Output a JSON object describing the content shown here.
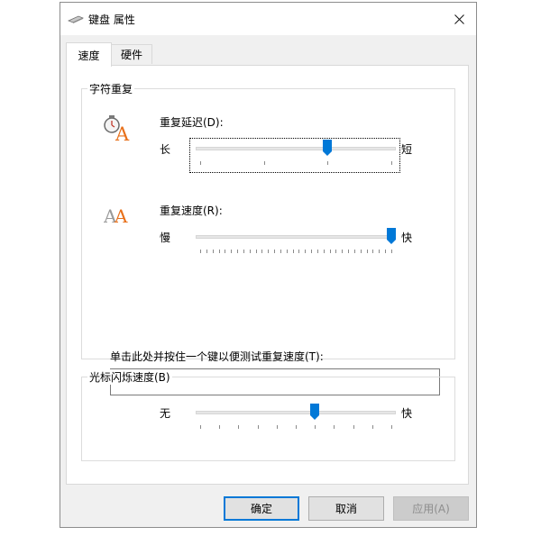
{
  "window": {
    "title": "键盘 属性",
    "icon": "keyboard-icon"
  },
  "tabs": [
    {
      "label": "速度",
      "active": true
    },
    {
      "label": "硬件",
      "active": false
    }
  ],
  "char_repeat": {
    "group_label": "字符重复",
    "delay": {
      "label": "重复延迟(D):",
      "min_label": "长",
      "max_label": "短",
      "value_fraction": 0.667,
      "tick_count": 4,
      "focused": true,
      "icon": "clock-letter-a-icon"
    },
    "rate": {
      "label": "重复速度(R):",
      "min_label": "慢",
      "max_label": "快",
      "value_fraction": 1.0,
      "tick_count": 32,
      "icon": "double-letter-a-icon"
    },
    "test": {
      "label": "单击此处并按住一个键以便测试重复速度(T):",
      "value": ""
    }
  },
  "cursor_blink": {
    "group_label": "光标闪烁速度(B)",
    "min_label": "无",
    "max_label": "快",
    "value_fraction": 0.6,
    "tick_count": 11
  },
  "buttons": {
    "ok": "确定",
    "cancel": "取消",
    "apply": "应用(A)"
  },
  "colors": {
    "accent": "#0078d7",
    "icon_orange": "#e8701a"
  }
}
